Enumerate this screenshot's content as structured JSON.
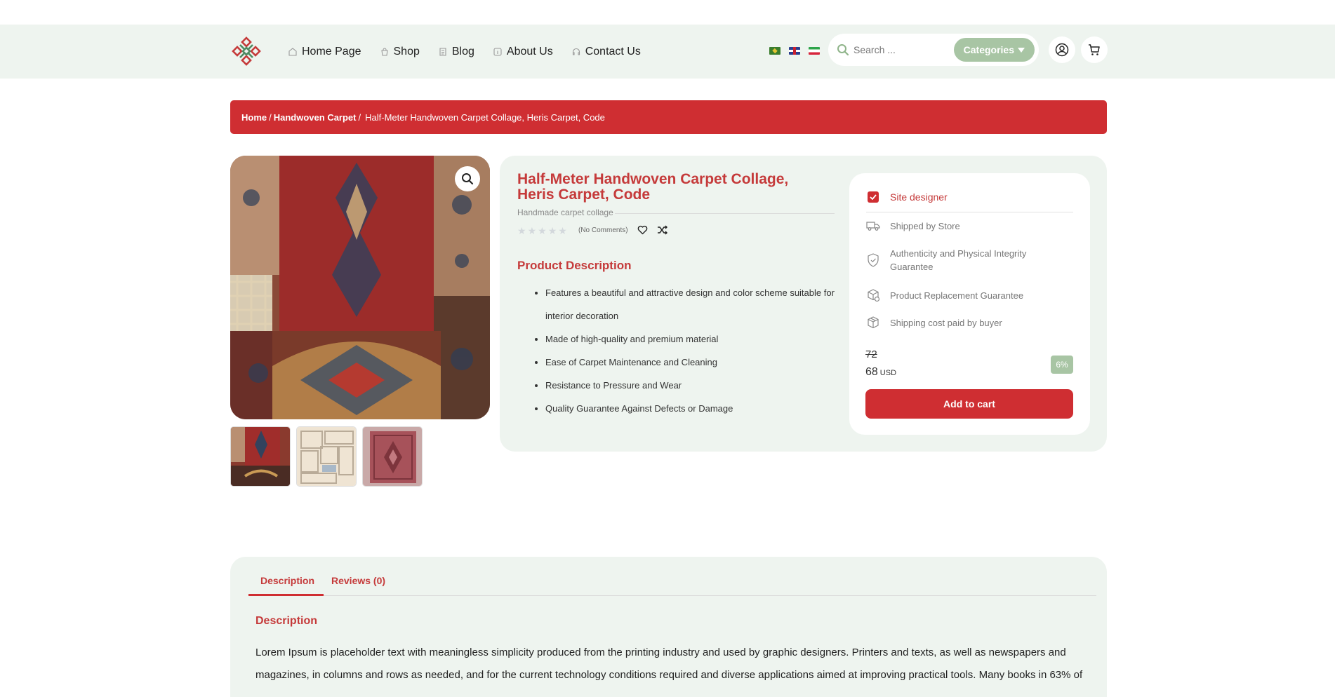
{
  "nav": {
    "items": [
      {
        "label": "Home Page"
      },
      {
        "label": "Shop"
      },
      {
        "label": "Blog"
      },
      {
        "label": "About Us"
      },
      {
        "label": "Contact Us"
      }
    ]
  },
  "search": {
    "placeholder": "Search ...",
    "categories_label": "Categories"
  },
  "breadcrumb": {
    "home": "Home",
    "sep1": "/",
    "category": "Handwoven Carpet",
    "sep2": "/",
    "current": "Half-Meter Handwoven Carpet Collage, Heris Carpet, Code"
  },
  "product": {
    "title": "Half-Meter Handwoven Carpet Collage, Heris Carpet, Code",
    "subtitle": "Handmade carpet collage",
    "rating": 0,
    "comments": "(No Comments)",
    "desc_title": "Product Description",
    "features": [
      "Features a beautiful and attractive design and color scheme suitable for interior decoration",
      "Made of high-quality and premium material",
      "Ease of Carpet Maintenance and Cleaning",
      "Resistance to Pressure and Wear",
      "Quality Guarantee Against Defects or Damage"
    ]
  },
  "box": {
    "designer": "Site designer",
    "shipped": "Shipped by Store",
    "authenticity": "Authenticity and Physical Integrity Guarantee",
    "replacement": "Product Replacement Guarantee",
    "shipping_cost": "Shipping cost paid by buyer",
    "old_price": "72",
    "new_price": "68",
    "currency": "USD",
    "discount": "6%",
    "add_to_cart": "Add to cart"
  },
  "tabs": {
    "description": "Description",
    "reviews": "Reviews (0)"
  },
  "description": {
    "heading": "Description",
    "text": "Lorem Ipsum is placeholder text with meaningless simplicity produced from the printing industry and used by graphic designers. Printers and texts, as well as newspapers and magazines, in columns and rows as needed, and for the current technology conditions required and diverse applications aimed at improving practical tools. Many books in 63% of"
  },
  "colors": {
    "brand_red": "#cf2e32",
    "title_red": "#c53a3a",
    "sage": "#a8c5a4",
    "panel": "#eef4ef"
  }
}
